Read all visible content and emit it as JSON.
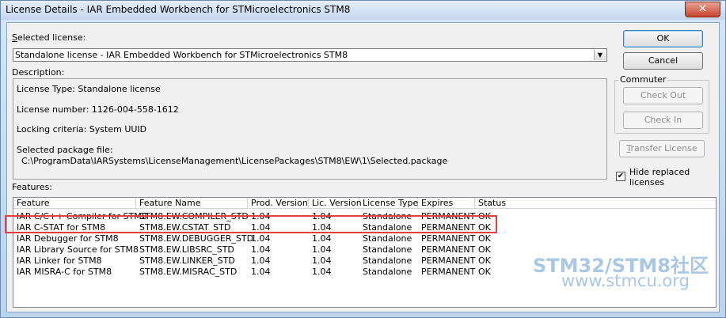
{
  "window": {
    "title": "License Details - IAR Embedded Workbench for STMicroelectronics STM8",
    "close_glyph": "✕"
  },
  "selected_license": {
    "label_u": "S",
    "label_rest": "elected license:",
    "value": "Standalone license - IAR Embedded Workbench for STMicroelectronics STM8",
    "arrow": "▼"
  },
  "description": {
    "label": "Description:",
    "license_type": "License Type: Standalone license",
    "license_number": "License number: 1126-004-558-1612",
    "locking": "Locking criteria: System UUID",
    "package_label": "Selected package file:",
    "package_path": "C:\\ProgramData\\IARSystems\\LicenseManagement\\LicensePackages\\STM8\\EW\\1\\Selected.package"
  },
  "buttons": {
    "ok": "OK",
    "cancel": "Cancel",
    "check_out": "Check Out",
    "check_in": "Check In",
    "transfer_u": "T",
    "transfer_rest": "ransfer License"
  },
  "commuter": {
    "title": "Commuter"
  },
  "hide_replaced": {
    "checked_glyph": "✔",
    "line1": "Hide replaced",
    "line2": "licenses"
  },
  "features": {
    "label": "Features:",
    "columns": [
      "Feature",
      "Feature Name",
      "Prod. Version",
      "Lic. Version",
      "License Type",
      "Expires",
      "Status"
    ],
    "rows": [
      [
        "IAR C/C++ Compiler for STM8",
        "STM8.EW.COMPILER_STD",
        "1.04",
        "1.04",
        "Standalone",
        "PERMANENT",
        "OK"
      ],
      [
        "IAR C-STAT for STM8",
        "STM8.EW.CSTAT_STD",
        "1.04",
        "1.04",
        "Standalone",
        "PERMANENT",
        "OK"
      ],
      [
        "IAR Debugger for STM8",
        "STM8.EW.DEBUGGER_STD",
        "1.04",
        "1.04",
        "Standalone",
        "PERMANENT",
        "OK"
      ],
      [
        "IAR Library Source for STM8",
        "STM8.EW.LIBSRC_STD",
        "1.04",
        "1.04",
        "Standalone",
        "PERMANENT",
        "OK"
      ],
      [
        "IAR Linker for STM8",
        "STM8.EW.LINKER_STD",
        "1.04",
        "1.04",
        "Standalone",
        "PERMANENT",
        "OK"
      ],
      [
        "IAR MISRA-C for STM8",
        "STM8.EW.MISRAC_STD",
        "1.04",
        "1.04",
        "Standalone",
        "PERMANENT",
        "OK"
      ]
    ]
  },
  "watermark": {
    "line1": "STM32/STM8社区",
    "line2": "www.stmcu.org"
  },
  "colors": {
    "highlight": "#e33f3f",
    "watermark": "#aac7e4"
  }
}
